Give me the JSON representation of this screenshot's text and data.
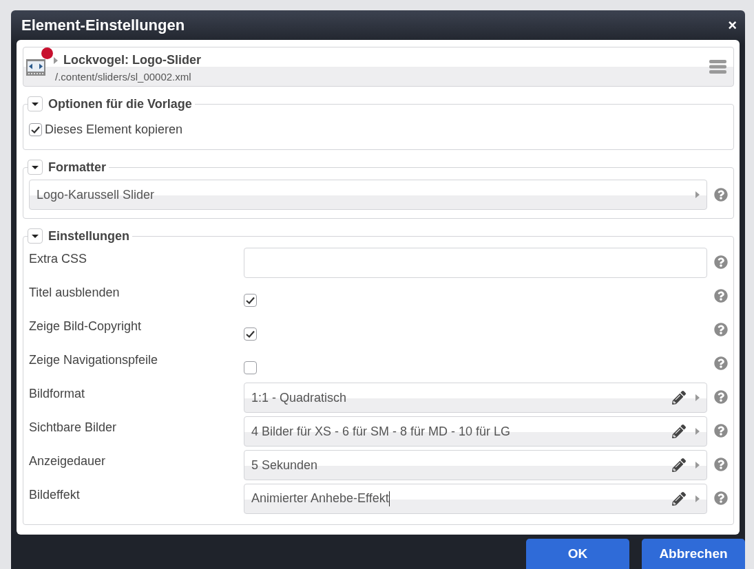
{
  "dialog": {
    "title": "Element-Einstellungen",
    "close": "×"
  },
  "element": {
    "title": "Lockvogel: Logo-Slider",
    "path": "/.content/sliders/sl_00002.xml",
    "modified": true
  },
  "sections": [
    {
      "title": "Optionen für die Vorlage",
      "expanded": true,
      "fields": [
        {
          "kind": "option",
          "label": "Dieses Element kopieren",
          "checked": true
        }
      ]
    },
    {
      "title": "Formatter",
      "expanded": true,
      "fields": [
        {
          "kind": "formatter",
          "value": "Logo-Karussell Slider"
        }
      ]
    },
    {
      "title": "Einstellungen",
      "expanded": true,
      "fields": [
        {
          "kind": "text",
          "label": "Extra CSS"
        },
        {
          "kind": "checkbox",
          "label": "Titel ausblenden",
          "checked": true
        },
        {
          "kind": "checkbox",
          "label": "Zeige Bild-Copyright",
          "checked": true
        },
        {
          "kind": "checkbox",
          "label": "Zeige Navigationspfeile",
          "checked": false
        },
        {
          "kind": "select",
          "label": "Bildformat",
          "value": "1:1 - Quadratisch",
          "focused": false
        },
        {
          "kind": "select",
          "label": "Sichtbare Bilder",
          "value": "4 Bilder für XS - 6 für SM - 8 für MD - 10 für LG",
          "focused": false
        },
        {
          "kind": "select",
          "label": "Anzeigedauer",
          "value": "5 Sekunden",
          "focused": false
        },
        {
          "kind": "select",
          "label": "Bildeffekt",
          "value": "Animierter Anhebe-Effekt",
          "focused": true
        }
      ]
    }
  ],
  "buttons": [
    {
      "label": "OK"
    },
    {
      "label": "Abbrechen"
    }
  ]
}
